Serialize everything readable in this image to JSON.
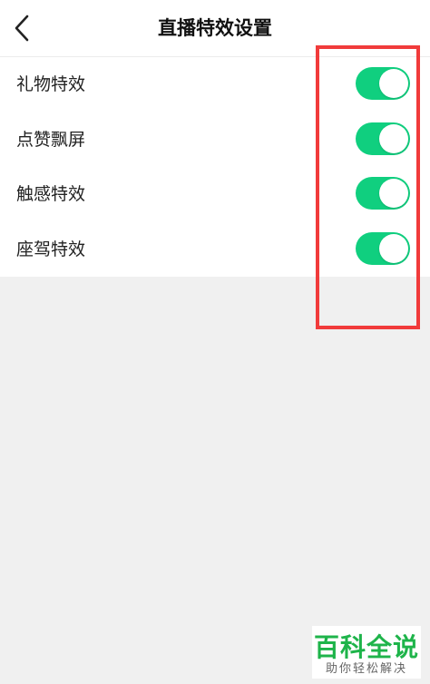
{
  "header": {
    "back_icon": "chevron-left-icon",
    "title": "直播特效设置"
  },
  "settings": {
    "items": [
      {
        "label": "礼物特效",
        "enabled": true
      },
      {
        "label": "点赞飘屏",
        "enabled": true
      },
      {
        "label": "触感特效",
        "enabled": true
      },
      {
        "label": "座驾特效",
        "enabled": true
      }
    ]
  },
  "colors": {
    "toggle_on": "#10cf7f",
    "highlight_box": "#f13b3b",
    "background": "#f0f0f0",
    "watermark_green": "#1eb44a"
  },
  "watermark": {
    "main": "百科全说",
    "sub": "助你轻松解决"
  }
}
